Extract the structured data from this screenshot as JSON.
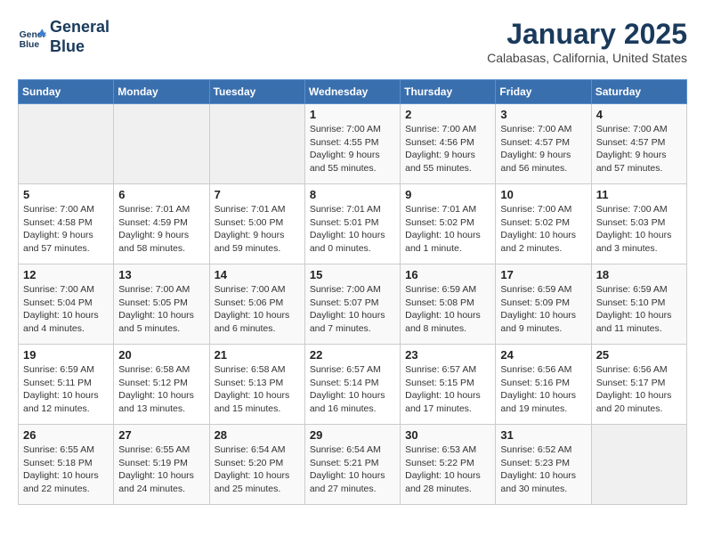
{
  "header": {
    "logo_line1": "General",
    "logo_line2": "Blue",
    "month": "January 2025",
    "location": "Calabasas, California, United States"
  },
  "days_of_week": [
    "Sunday",
    "Monday",
    "Tuesday",
    "Wednesday",
    "Thursday",
    "Friday",
    "Saturday"
  ],
  "weeks": [
    [
      {
        "day": "",
        "sunrise": "",
        "sunset": "",
        "daylight": ""
      },
      {
        "day": "",
        "sunrise": "",
        "sunset": "",
        "daylight": ""
      },
      {
        "day": "",
        "sunrise": "",
        "sunset": "",
        "daylight": ""
      },
      {
        "day": "1",
        "sunrise": "Sunrise: 7:00 AM",
        "sunset": "Sunset: 4:55 PM",
        "daylight": "Daylight: 9 hours and 55 minutes."
      },
      {
        "day": "2",
        "sunrise": "Sunrise: 7:00 AM",
        "sunset": "Sunset: 4:56 PM",
        "daylight": "Daylight: 9 hours and 55 minutes."
      },
      {
        "day": "3",
        "sunrise": "Sunrise: 7:00 AM",
        "sunset": "Sunset: 4:57 PM",
        "daylight": "Daylight: 9 hours and 56 minutes."
      },
      {
        "day": "4",
        "sunrise": "Sunrise: 7:00 AM",
        "sunset": "Sunset: 4:57 PM",
        "daylight": "Daylight: 9 hours and 57 minutes."
      }
    ],
    [
      {
        "day": "5",
        "sunrise": "Sunrise: 7:00 AM",
        "sunset": "Sunset: 4:58 PM",
        "daylight": "Daylight: 9 hours and 57 minutes."
      },
      {
        "day": "6",
        "sunrise": "Sunrise: 7:01 AM",
        "sunset": "Sunset: 4:59 PM",
        "daylight": "Daylight: 9 hours and 58 minutes."
      },
      {
        "day": "7",
        "sunrise": "Sunrise: 7:01 AM",
        "sunset": "Sunset: 5:00 PM",
        "daylight": "Daylight: 9 hours and 59 minutes."
      },
      {
        "day": "8",
        "sunrise": "Sunrise: 7:01 AM",
        "sunset": "Sunset: 5:01 PM",
        "daylight": "Daylight: 10 hours and 0 minutes."
      },
      {
        "day": "9",
        "sunrise": "Sunrise: 7:01 AM",
        "sunset": "Sunset: 5:02 PM",
        "daylight": "Daylight: 10 hours and 1 minute."
      },
      {
        "day": "10",
        "sunrise": "Sunrise: 7:00 AM",
        "sunset": "Sunset: 5:02 PM",
        "daylight": "Daylight: 10 hours and 2 minutes."
      },
      {
        "day": "11",
        "sunrise": "Sunrise: 7:00 AM",
        "sunset": "Sunset: 5:03 PM",
        "daylight": "Daylight: 10 hours and 3 minutes."
      }
    ],
    [
      {
        "day": "12",
        "sunrise": "Sunrise: 7:00 AM",
        "sunset": "Sunset: 5:04 PM",
        "daylight": "Daylight: 10 hours and 4 minutes."
      },
      {
        "day": "13",
        "sunrise": "Sunrise: 7:00 AM",
        "sunset": "Sunset: 5:05 PM",
        "daylight": "Daylight: 10 hours and 5 minutes."
      },
      {
        "day": "14",
        "sunrise": "Sunrise: 7:00 AM",
        "sunset": "Sunset: 5:06 PM",
        "daylight": "Daylight: 10 hours and 6 minutes."
      },
      {
        "day": "15",
        "sunrise": "Sunrise: 7:00 AM",
        "sunset": "Sunset: 5:07 PM",
        "daylight": "Daylight: 10 hours and 7 minutes."
      },
      {
        "day": "16",
        "sunrise": "Sunrise: 6:59 AM",
        "sunset": "Sunset: 5:08 PM",
        "daylight": "Daylight: 10 hours and 8 minutes."
      },
      {
        "day": "17",
        "sunrise": "Sunrise: 6:59 AM",
        "sunset": "Sunset: 5:09 PM",
        "daylight": "Daylight: 10 hours and 9 minutes."
      },
      {
        "day": "18",
        "sunrise": "Sunrise: 6:59 AM",
        "sunset": "Sunset: 5:10 PM",
        "daylight": "Daylight: 10 hours and 11 minutes."
      }
    ],
    [
      {
        "day": "19",
        "sunrise": "Sunrise: 6:59 AM",
        "sunset": "Sunset: 5:11 PM",
        "daylight": "Daylight: 10 hours and 12 minutes."
      },
      {
        "day": "20",
        "sunrise": "Sunrise: 6:58 AM",
        "sunset": "Sunset: 5:12 PM",
        "daylight": "Daylight: 10 hours and 13 minutes."
      },
      {
        "day": "21",
        "sunrise": "Sunrise: 6:58 AM",
        "sunset": "Sunset: 5:13 PM",
        "daylight": "Daylight: 10 hours and 15 minutes."
      },
      {
        "day": "22",
        "sunrise": "Sunrise: 6:57 AM",
        "sunset": "Sunset: 5:14 PM",
        "daylight": "Daylight: 10 hours and 16 minutes."
      },
      {
        "day": "23",
        "sunrise": "Sunrise: 6:57 AM",
        "sunset": "Sunset: 5:15 PM",
        "daylight": "Daylight: 10 hours and 17 minutes."
      },
      {
        "day": "24",
        "sunrise": "Sunrise: 6:56 AM",
        "sunset": "Sunset: 5:16 PM",
        "daylight": "Daylight: 10 hours and 19 minutes."
      },
      {
        "day": "25",
        "sunrise": "Sunrise: 6:56 AM",
        "sunset": "Sunset: 5:17 PM",
        "daylight": "Daylight: 10 hours and 20 minutes."
      }
    ],
    [
      {
        "day": "26",
        "sunrise": "Sunrise: 6:55 AM",
        "sunset": "Sunset: 5:18 PM",
        "daylight": "Daylight: 10 hours and 22 minutes."
      },
      {
        "day": "27",
        "sunrise": "Sunrise: 6:55 AM",
        "sunset": "Sunset: 5:19 PM",
        "daylight": "Daylight: 10 hours and 24 minutes."
      },
      {
        "day": "28",
        "sunrise": "Sunrise: 6:54 AM",
        "sunset": "Sunset: 5:20 PM",
        "daylight": "Daylight: 10 hours and 25 minutes."
      },
      {
        "day": "29",
        "sunrise": "Sunrise: 6:54 AM",
        "sunset": "Sunset: 5:21 PM",
        "daylight": "Daylight: 10 hours and 27 minutes."
      },
      {
        "day": "30",
        "sunrise": "Sunrise: 6:53 AM",
        "sunset": "Sunset: 5:22 PM",
        "daylight": "Daylight: 10 hours and 28 minutes."
      },
      {
        "day": "31",
        "sunrise": "Sunrise: 6:52 AM",
        "sunset": "Sunset: 5:23 PM",
        "daylight": "Daylight: 10 hours and 30 minutes."
      },
      {
        "day": "",
        "sunrise": "",
        "sunset": "",
        "daylight": ""
      }
    ]
  ]
}
